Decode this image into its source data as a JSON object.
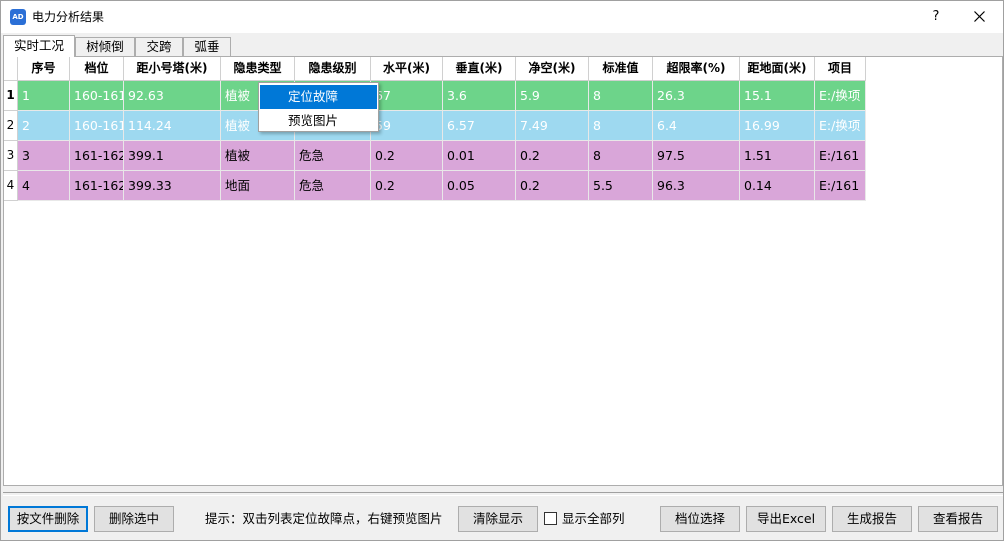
{
  "window": {
    "title": "电力分析结果",
    "icon": "app-logo-icon",
    "icon_text": "AD",
    "help_label": "?",
    "close_icon": "close-icon"
  },
  "tabs": [
    {
      "label": "实时工况",
      "active": true
    },
    {
      "label": "树倾倒",
      "active": false
    },
    {
      "label": "交跨",
      "active": false
    },
    {
      "label": "弧垂",
      "active": false
    }
  ],
  "table": {
    "columns": [
      "序号",
      "档位",
      "距小号塔(米)",
      "隐患类型",
      "隐患级别",
      "水平(米)",
      "垂直(米)",
      "净空(米)",
      "标准值",
      "超限率(%)",
      "距地面(米)",
      "项目"
    ],
    "rows": [
      {
        "header": "1",
        "color": "#6dd48a",
        "cells": [
          "1",
          "160-161",
          "92.63",
          "植被",
          "",
          "67",
          "3.6",
          "5.9",
          "8",
          "26.3",
          "15.1",
          "E:/换项"
        ]
      },
      {
        "header": "2",
        "color": "#9ed9f0",
        "cells": [
          "2",
          "160-161",
          "114.24",
          "植被",
          "",
          "59",
          "6.57",
          "7.49",
          "8",
          "6.4",
          "16.99",
          "E:/换项"
        ]
      },
      {
        "header": "3",
        "color": "#d9a6d9",
        "cells": [
          "3",
          "161-162",
          "399.1",
          "植被",
          "危急",
          "0.2",
          "0.01",
          "0.2",
          "8",
          "97.5",
          "1.51",
          "E:/161"
        ]
      },
      {
        "header": "4",
        "color": "#d9a6d9",
        "cells": [
          "4",
          "161-162",
          "399.33",
          "地面",
          "危急",
          "0.2",
          "0.05",
          "0.2",
          "5.5",
          "96.3",
          "0.14",
          "E:/161"
        ]
      }
    ]
  },
  "context_menu": {
    "items": [
      {
        "label": "定位故障",
        "highlighted": true
      },
      {
        "label": "预览图片",
        "highlighted": false
      }
    ]
  },
  "footer": {
    "delete_by_file": "按文件删除",
    "delete_selected": "删除选中",
    "hint": "提示：双击列表定位故障点，右键预览图片",
    "clear_display": "清除显示",
    "show_all_label": "显示全部列",
    "show_all_checked": false,
    "span_select": "档位选择",
    "export_excel": "导出Excel",
    "generate_report": "生成报告",
    "view_report": "查看报告"
  },
  "colors": {
    "row_selected_text": "#ffffff",
    "menu_highlight": "#0078d7"
  }
}
